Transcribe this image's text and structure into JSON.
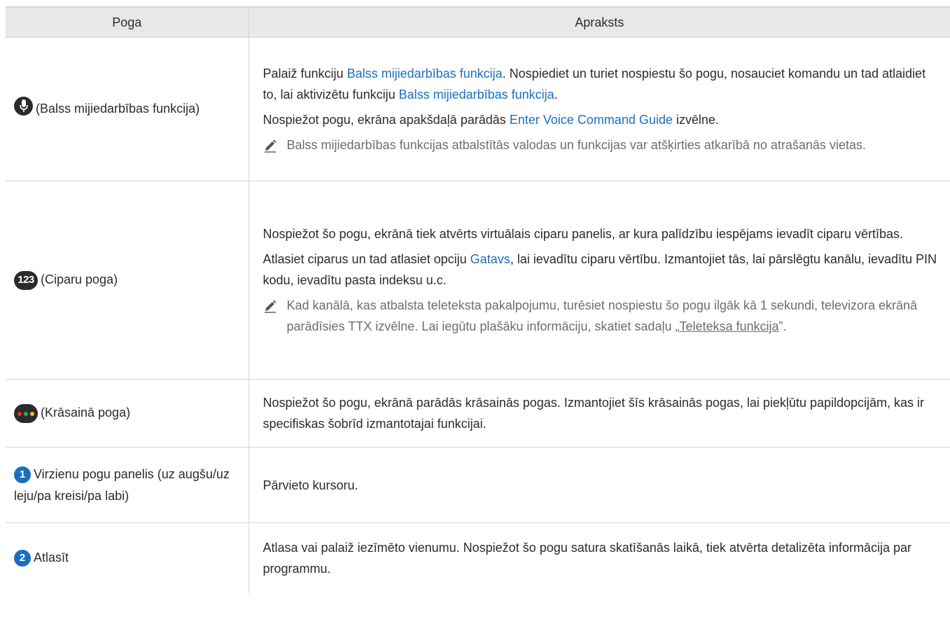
{
  "header": {
    "col1": "Poga",
    "col2": "Apraksts"
  },
  "colors": {
    "accent": "#1a6fc1",
    "red": "#e0312e",
    "green": "#2fa84f",
    "yellow": "#f2c21a"
  },
  "rows": [
    {
      "icon": "microphone-icon",
      "label": "(Balss mijiedarbības funkcija)",
      "p1": {
        "t1": "Palaiž funkciju ",
        "h1": "Balss mijiedarbības funkcija",
        "t2": ". Nospiediet un turiet nospiestu šo pogu, nosauciet komandu un tad atlaidiet to, lai aktivizētu funkciju ",
        "h2": "Balss mijiedarbības funkcija",
        "t3": "."
      },
      "p2": {
        "t1": "Nospiežot pogu, ekrāna apakšdaļā parādās ",
        "h1": "Enter Voice Command Guide",
        "t2": " izvēlne."
      },
      "note": "Balss mijiedarbības funkcijas atbalstītās valodas un funkcijas var atšķirties atkarībā no atrašanās vietas."
    },
    {
      "icon": "number-123-icon",
      "icon_text": "123",
      "label": "(Ciparu poga)",
      "p1": "Nospiežot šo pogu, ekrānā tiek atvērts virtuālais ciparu panelis, ar kura palīdzību iespējams ievadīt ciparu vērtības.",
      "p2": {
        "t1": "Atlasiet ciparus un tad atlasiet opciju ",
        "h1": "Gatavs",
        "t2": ", lai ievadītu ciparu vērtību. Izmantojiet tās, lai pārslēgtu kanālu, ievadītu PIN kodu, ievadītu pasta indeksu u.c."
      },
      "note": {
        "t1": "Kad kanālā, kas atbalsta teleteksta pakalpojumu, turēsiet nospiestu šo pogu ilgāk kā 1 sekundi, televizora ekrānā parādīsies TTX izvēlne. Lai iegūtu plašāku informāciju, skatiet sadaļu „",
        "link": "Teleteksa funkcija",
        "t2": "”."
      }
    },
    {
      "icon": "color-buttons-icon",
      "label": "(Krāsainā poga)",
      "p1": "Nospiežot šo pogu, ekrānā parādās krāsainās pogas. Izmantojiet šīs krāsainās pogas, lai piekļūtu papildopcijām, kas ir specifiskas šobrīd izmantotajai funkcijai."
    },
    {
      "icon": "circled-1-icon",
      "icon_text": "1",
      "label": "Virzienu pogu panelis (uz augšu/uz leju/pa kreisi/pa labi)",
      "p1": "Pārvieto kursoru."
    },
    {
      "icon": "circled-2-icon",
      "icon_text": "2",
      "label": "Atlasīt",
      "p1": "Atlasa vai palaiž iezīmēto vienumu. Nospiežot šo pogu satura skatīšanās laikā, tiek atvērta detalizēta informācija par programmu."
    }
  ]
}
